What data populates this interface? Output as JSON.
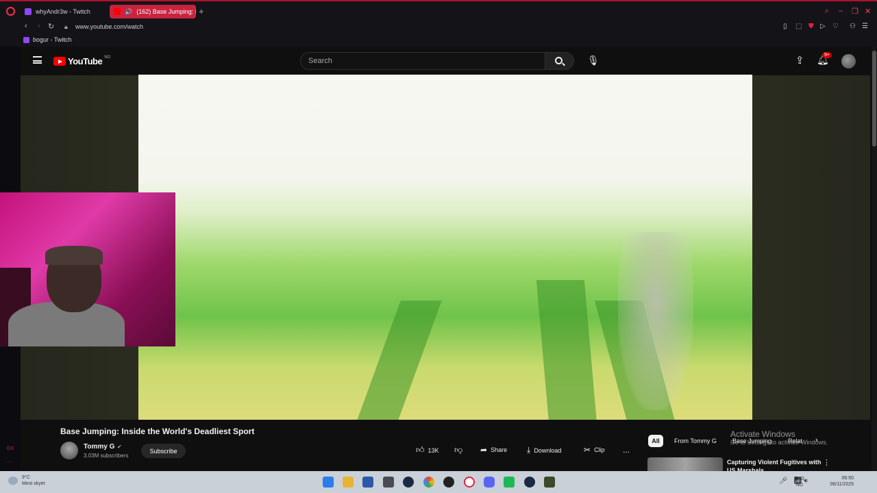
{
  "browser": {
    "tabs": [
      {
        "label": "whyAndr3w - Twitch"
      },
      {
        "label": "(162) Base Jumping: I"
      }
    ],
    "url": "www.youtube.com/watch",
    "bookmarks": [
      {
        "label": "bogur - Twitch"
      }
    ],
    "gx_label": "GX",
    "sidebar_more": "..."
  },
  "youtube": {
    "logo_text": "YouTube",
    "country_code": "NO",
    "search_placeholder": "Search",
    "notification_badge": "9+"
  },
  "video": {
    "title": "Base Jumping: Inside the World's Deadliest Sport",
    "channel": "Tommy G",
    "subscribers": "3.03M subscribers",
    "subscribe_label": "Subscribe",
    "likes": "13K",
    "share_label": "Share",
    "download_label": "Download",
    "clip_label": "Clip",
    "more_label": "..."
  },
  "filters": {
    "all": "All",
    "from": "From Tommy G",
    "base": "Base Jumping",
    "related": "Relat"
  },
  "related": [
    {
      "title": "Capturing Violent Fugitives with US Marshals"
    }
  ],
  "watermark": {
    "line1": "Activate Windows",
    "line2": "Go to Settings to activate Windows."
  },
  "taskbar": {
    "weather_temp": "9°C",
    "weather_desc": "Mest skyet",
    "lang1": "ENG",
    "lang2": "NO",
    "time": "06:50",
    "date": "06/11/2025"
  },
  "colors": {
    "accent": "#c8233f",
    "youtube_red": "#ff0000"
  }
}
